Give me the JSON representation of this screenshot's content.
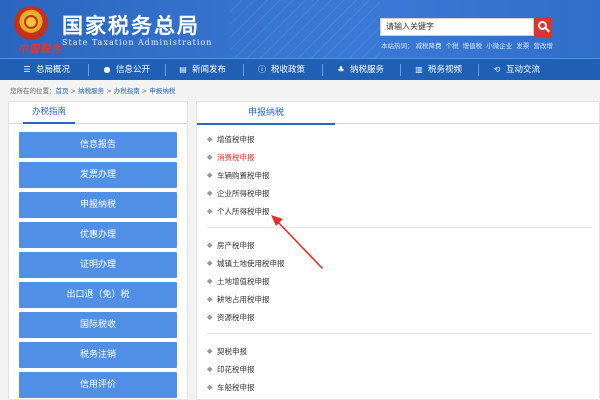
{
  "header": {
    "logo_text": "中国税务",
    "site_title": "国家税务总局",
    "site_subtitle": "State Taxation Administration",
    "search_value": "请输入关键字",
    "hot_label": "本站热词：",
    "hot_words": [
      "减税降费",
      "个税",
      "增值税",
      "小微企业",
      "发票",
      "营改增"
    ]
  },
  "nav": [
    {
      "icon": "☰",
      "label": "总局概况"
    },
    {
      "icon": "●",
      "label": "信息公开"
    },
    {
      "icon": "▤",
      "label": "新闻发布"
    },
    {
      "icon": "ⓘ",
      "label": "税收政策"
    },
    {
      "icon": "♣",
      "label": "纳税服务"
    },
    {
      "icon": "▥",
      "label": "税务视频"
    },
    {
      "icon": "⟲",
      "label": "互动交流"
    }
  ],
  "breadcrumb": {
    "prefix": "您所在的位置：",
    "links": [
      "首页",
      "纳税服务",
      "办税指南",
      "申报纳税"
    ],
    "separator": ">"
  },
  "sidebar": {
    "tab": "办税指南",
    "items": [
      "信息报告",
      "发票办理",
      "申报纳税",
      "优惠办理",
      "证明办理",
      "出口退（免）税",
      "国际税收",
      "税务注销",
      "信用评价"
    ]
  },
  "main": {
    "tab": "申报纳税",
    "groups": [
      [
        "增值税申报",
        "消费税申报",
        "车辆购置税申报",
        "企业所得税申报",
        "个人所得税申报"
      ],
      [
        "房产税申报",
        "城镇土地使用税申报",
        "土地增值税申报",
        "耕地占用税申报",
        "资源税申报"
      ],
      [
        "契税申报",
        "印花税申报",
        "车船税申报"
      ]
    ]
  },
  "colors": {
    "brand_blue": "#2f6fc9",
    "nav_blue": "#1f5fb4",
    "button_blue": "#4f8fe6",
    "highlight_red": "#e0312b",
    "search_red": "#d8372f"
  }
}
